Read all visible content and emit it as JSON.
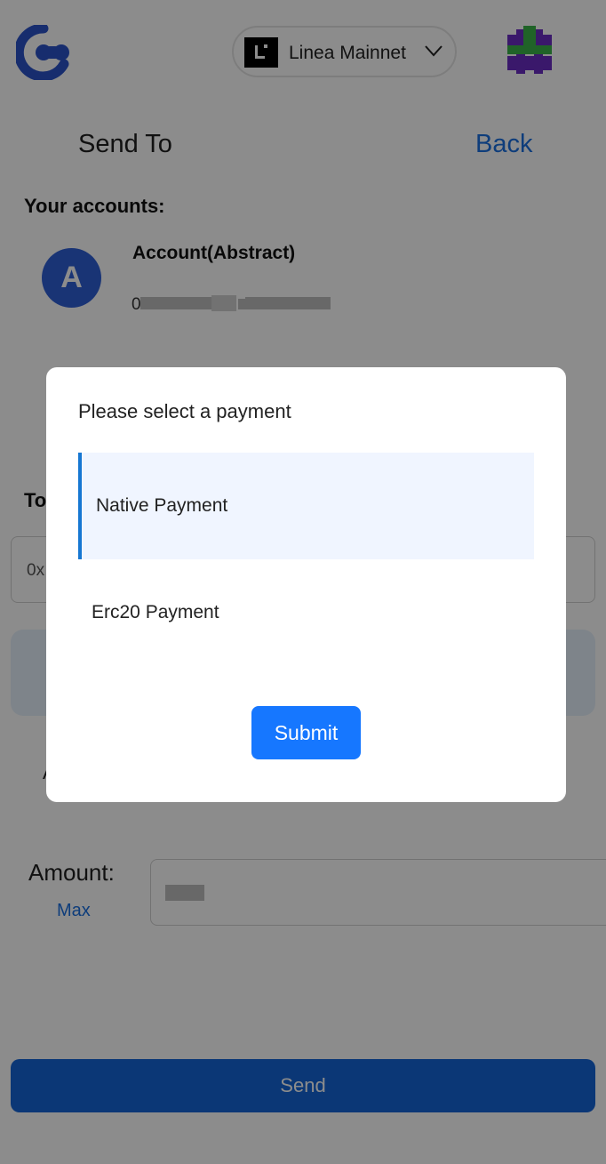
{
  "header": {
    "logo_icon": "app-c-logo-icon",
    "network": {
      "label": "Linea Mainnet",
      "icon": "linea-l-icon",
      "chevron": "chevron-down-icon"
    },
    "user_logo_icon": "user-avatar-hash-icon"
  },
  "send_page": {
    "title": "Send To",
    "back_label": "Back",
    "accounts_label": "Your accounts:",
    "account": {
      "avatar_letter": "A",
      "name": "Account(Abstract)",
      "address_visible_char": "0"
    },
    "to_label": "To",
    "to_input_value": "0x",
    "partial_label": "A",
    "amount_label": "Amount:",
    "max_label": "Max",
    "send_label": "Send"
  },
  "modal": {
    "title": "Please select a payment",
    "options": [
      {
        "label": "Native Payment",
        "selected": true
      },
      {
        "label": "Erc20 Payment",
        "selected": false
      }
    ],
    "submit_label": "Submit"
  },
  "colors": {
    "accent": "#1677ff",
    "link": "#1b6fe0",
    "avatar": "#2f5fd6",
    "selected_bg": "#f0f5ff",
    "selected_border": "#1677d2",
    "send_button": "#1565d8"
  }
}
